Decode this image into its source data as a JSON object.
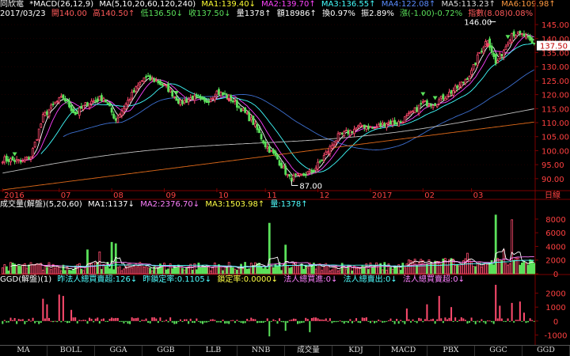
{
  "colors": {
    "up": "#ff4b6e",
    "down": "#5be15b",
    "axis": "#7d0000",
    "grid": "#3a0000",
    "ma1": "#ffffff",
    "ma2": "#ff40ff",
    "ma3": "#40ffff",
    "ma4": "#3d6fd0",
    "ma5": "#bfbfbf",
    "ma6": "#e06a1a",
    "vol_ma1": "#ffffff",
    "vol_ma2": "#ff80ff",
    "vol_ma3": "#50ffff"
  },
  "header": {
    "line1": {
      "stock": "同欣電",
      "macd": "*MACD(26,12,9)",
      "ma_set": "MA(5,10,20,60,120,240)",
      "ma1": "MA1:139.40↓",
      "ma2": "MA2:139.70↑",
      "ma3": "MA3:136.55↑",
      "ma4": "MA4:122.08↑",
      "ma5": "MA5:113.23↑",
      "ma6": "MA6:109.98↑"
    },
    "line2": {
      "date": "2017/03/23",
      "open": "開140.00",
      "high": "高140.50↑",
      "low": "低136.50↓",
      "close": "收137.50↓",
      "vol": "量1378↑",
      "amount": "額18986↑",
      "turnover": "換0.97%",
      "amplitude": "振2.89%",
      "change": "漲(-1.00)-0.72%",
      "index": "指數(8.08)0.08%"
    }
  },
  "volume_header": {
    "title": "成交量(解盤)(5,20,60)",
    "ma1": "MA1:1137↓",
    "ma2": "MA2:2376.70↓",
    "ma3": "MA3:1503.98↑",
    "vol": "量:1378↑"
  },
  "ggd_header": {
    "title": "GGD(解盤)(1)",
    "a": "昨法人總買賣超:126↓",
    "b": "昨鎖定率:0.1105↓",
    "c": "鎖定率:0.0000↓",
    "d": "法人總買進:0↓",
    "e": "法人總賣出:0↓",
    "f": "法人總買賣超:0↓"
  },
  "price_axis": {
    "ticks": [
      "145.00",
      "140.00",
      "135.00",
      "130.00",
      "125.00",
      "120.00",
      "115.00",
      "110.00",
      "105.00",
      "100.00",
      "95.00",
      "90.00"
    ],
    "current": "137.50",
    "high_label": "146.00",
    "low_label": "87.00"
  },
  "time_axis": {
    "labels": [
      "2016",
      "07",
      "08",
      "09",
      "10",
      "11",
      "12",
      "2017",
      "02",
      "03"
    ],
    "unit": "日線"
  },
  "volume_axis": {
    "ticks": [
      "8000",
      "6000",
      "4000",
      "2000",
      "0"
    ]
  },
  "ggd_axis": {
    "ticks": [
      "2000",
      "1000",
      "0",
      "-1000"
    ]
  },
  "tabs": [
    "MA",
    "BOLL",
    "GGA",
    "GGB",
    "LLB",
    "NNB",
    "成交量",
    "KDJ",
    "MACD",
    "PBX",
    "GGC",
    "GGD"
  ],
  "chart_data": [
    {
      "type": "candlestick",
      "ylim": [
        86,
        147
      ],
      "anchors": [
        [
          0,
          97
        ],
        [
          10,
          96
        ],
        [
          14,
          98
        ],
        [
          20,
          112
        ],
        [
          26,
          117
        ],
        [
          30,
          119
        ],
        [
          36,
          113
        ],
        [
          42,
          117
        ],
        [
          50,
          119
        ],
        [
          56,
          111
        ],
        [
          64,
          120
        ],
        [
          70,
          126
        ],
        [
          76,
          125
        ],
        [
          82,
          122
        ],
        [
          88,
          117
        ],
        [
          94,
          119
        ],
        [
          100,
          117
        ],
        [
          106,
          121
        ],
        [
          112,
          119
        ],
        [
          118,
          115
        ],
        [
          124,
          110
        ],
        [
          130,
          102
        ],
        [
          136,
          97
        ],
        [
          142,
          90
        ],
        [
          148,
          91
        ],
        [
          154,
          93
        ],
        [
          160,
          99
        ],
        [
          166,
          105
        ],
        [
          172,
          107
        ],
        [
          178,
          109
        ],
        [
          184,
          108
        ],
        [
          190,
          110
        ],
        [
          196,
          110
        ],
        [
          202,
          113
        ],
        [
          208,
          117
        ],
        [
          214,
          117
        ],
        [
          220,
          120
        ],
        [
          226,
          123
        ],
        [
          232,
          128
        ],
        [
          236,
          135
        ],
        [
          240,
          140
        ],
        [
          244,
          131
        ],
        [
          248,
          136
        ],
        [
          252,
          142
        ],
        [
          258,
          141
        ],
        [
          262,
          138
        ]
      ],
      "extremes": {
        "high": 146.0,
        "low": 87.0
      }
    },
    {
      "type": "bar",
      "name": "volume",
      "ylim": [
        0,
        9500
      ],
      "spikes": [
        [
          42,
          3500
        ],
        [
          48,
          3200
        ],
        [
          54,
          4600
        ],
        [
          56,
          4400
        ],
        [
          132,
          7400
        ],
        [
          140,
          4200
        ],
        [
          244,
          8600
        ],
        [
          248,
          3500
        ],
        [
          252,
          7900
        ],
        [
          230,
          3000
        ]
      ]
    },
    {
      "type": "bar",
      "name": "GGD",
      "ylim": [
        -1600,
        2600
      ],
      "spikes": [
        [
          20,
          1600
        ],
        [
          22,
          1200
        ],
        [
          28,
          1900
        ],
        [
          30,
          1800
        ],
        [
          34,
          800
        ],
        [
          132,
          -1100
        ],
        [
          140,
          -700
        ],
        [
          152,
          -800
        ],
        [
          200,
          900
        ],
        [
          210,
          1200
        ],
        [
          216,
          1800
        ],
        [
          222,
          1000
        ],
        [
          244,
          2600
        ],
        [
          246,
          1100
        ],
        [
          252,
          1300
        ],
        [
          256,
          1400
        ],
        [
          258,
          600
        ]
      ]
    }
  ]
}
